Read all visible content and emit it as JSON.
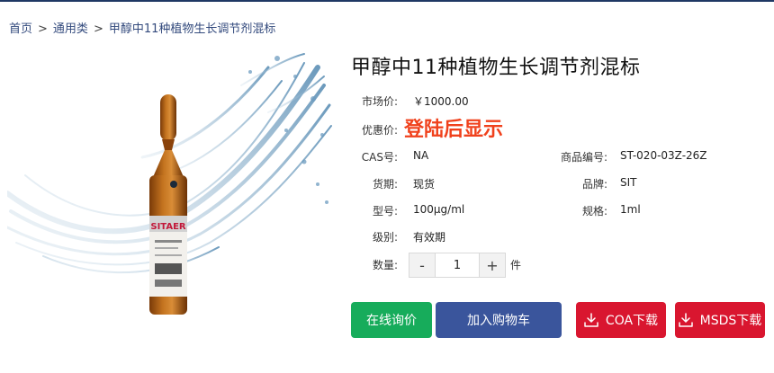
{
  "breadcrumb": {
    "home": "首页",
    "category": "通用类",
    "current": "甲醇中11种植物生长调节剂混标",
    "separator": ">"
  },
  "product": {
    "title": "甲醇中11种植物生长调节剂混标",
    "market_price_label": "市场价:",
    "market_price": "￥1000.00",
    "promo_price_label": "优惠价:",
    "promo_price_text": "登陆后显示",
    "cas_label": "CAS号:",
    "cas": "NA",
    "code_label": "商品编号:",
    "code": "ST-020-03Z-26Z",
    "stock_label": "货期:",
    "stock": "现货",
    "brand_label": "品牌:",
    "brand": "SIT",
    "model_label": "型号:",
    "model": "100μg/ml",
    "spec_label": "规格:",
    "spec": "1ml",
    "grade_label": "级别:",
    "grade": "有效期",
    "ampoule_label_text": "SITAER"
  },
  "quantity": {
    "label": "数量:",
    "value": "1",
    "minus": "-",
    "plus": "+",
    "unit": "件"
  },
  "actions": {
    "inquiry": "在线询价",
    "add_cart": "加入购物车",
    "coa": "COA下载",
    "msds": "MSDS下载"
  },
  "colors": {
    "breadcrumb": "#334a7d",
    "promo": "#f0411c",
    "inquiry": "#17ac5b",
    "cart": "#3a559c",
    "download": "#d9162f"
  },
  "icons": {
    "download": "download-icon"
  }
}
